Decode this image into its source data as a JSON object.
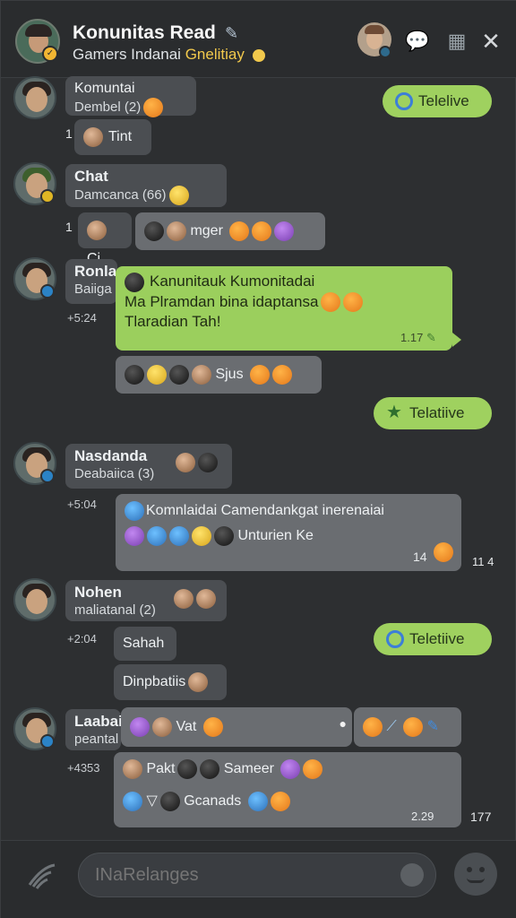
{
  "header": {
    "title": "Konunitas Read",
    "subtitle_prefix": "Gamers Indanai",
    "subtitle_highlight": "Gnelitiay"
  },
  "messages": [
    {
      "name": "Komuntai",
      "sub": "Dembel (2)",
      "reply": "Tint"
    },
    {
      "name": "Chat",
      "sub": "Damcanca (66)",
      "reply": "Ci",
      "reaction_text": "mger"
    },
    {
      "name": "Ronla",
      "sub": "Baiiga",
      "time": "+5:24",
      "green_lines": [
        "Kanunitauk Kumonitadai",
        "Ma Plramdan bina idaptansa",
        "Tlaradian Tah!"
      ],
      "green_time": "1.17",
      "react_text": "Sjus"
    },
    {
      "name": "Nasdanda",
      "sub": "Deabaiica (3)",
      "time": "+5:04",
      "line1": "Komnlaidai Camendankgat inerenaiai",
      "line2": "Unturien Ke",
      "count_a": "14",
      "count_b": "11 4"
    },
    {
      "name": "Nohen",
      "sub": "maliatanal (2)",
      "time": "+2:04",
      "reply1": "Sahah",
      "reply2": "Dinpbatiis"
    },
    {
      "name": "Laabai",
      "sub": "peantal",
      "time": "+4353",
      "inline_text": "Vat",
      "row1_a": "Pakt",
      "row1_b": "Sameer",
      "row2": "Gcanads",
      "count_a": "2.29",
      "count_b": "177"
    }
  ],
  "pills": [
    {
      "label": "Telelive"
    },
    {
      "label": "Telatiive"
    },
    {
      "label": "Teletiive"
    }
  ],
  "thread_counts": [
    "1",
    "1"
  ],
  "input": {
    "placeholder": "INaRelanges"
  },
  "colors": {
    "green_bubble": "#9bcf5d",
    "pill": "#9fd15f",
    "accent_yellow": "#f2c94c"
  }
}
